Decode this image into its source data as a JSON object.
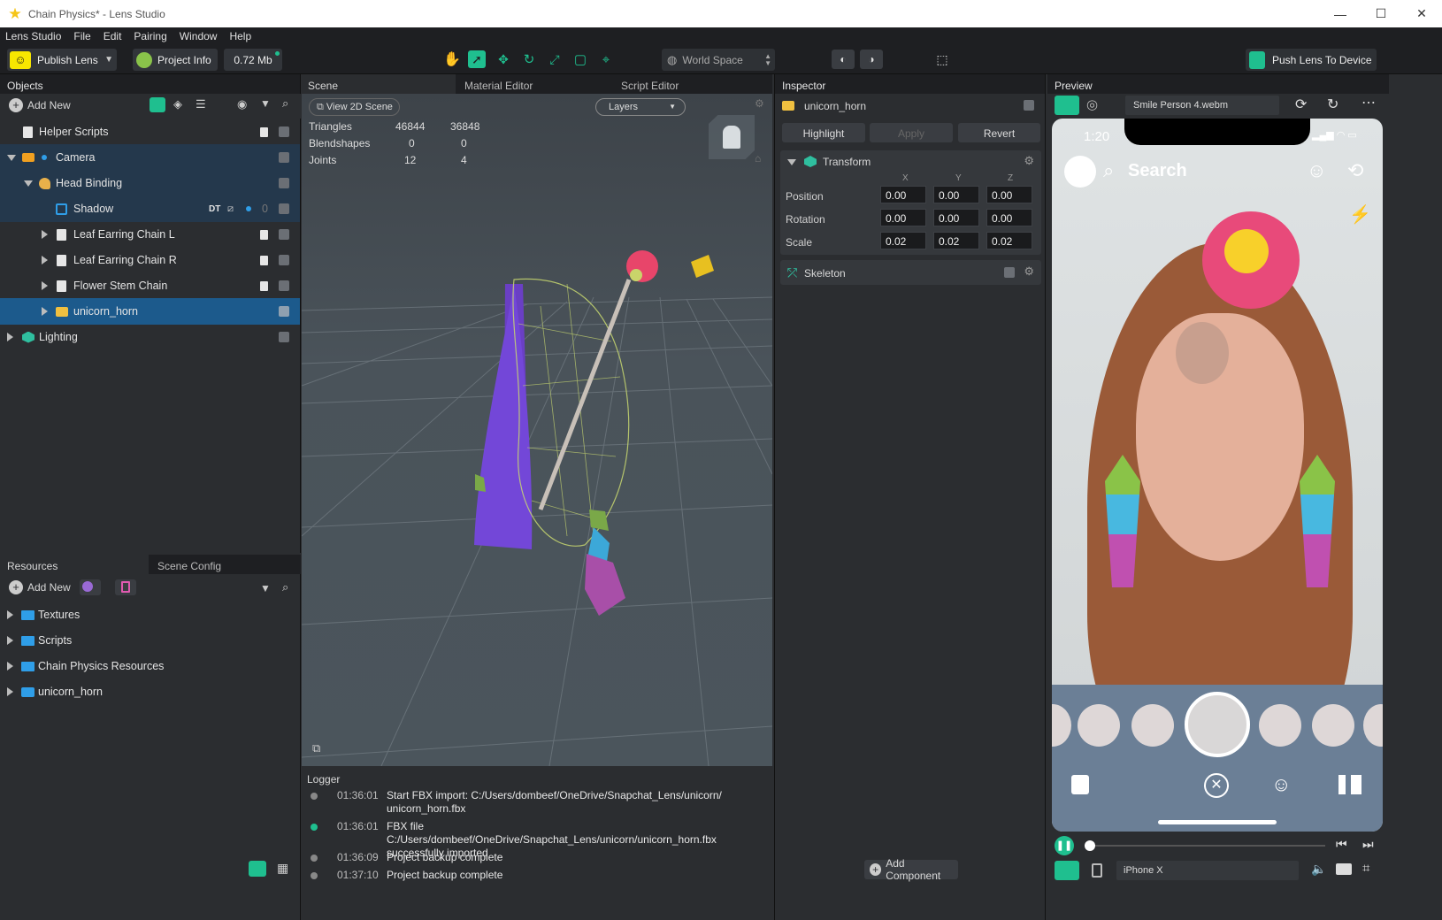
{
  "window": {
    "title": "Chain Physics* - Lens Studio",
    "min": "—",
    "max": "☐",
    "close": "✕"
  },
  "menu": [
    "Lens Studio",
    "File",
    "Edit",
    "Pairing",
    "Window",
    "Help"
  ],
  "toolbar": {
    "publish_label": "Publish Lens",
    "project_info_label": "Project Info",
    "size_label": "0.72 Mb",
    "space_label": "World Space",
    "push_label": "Push Lens To Device"
  },
  "objects": {
    "title": "Objects",
    "add_new": "Add New",
    "items": [
      {
        "label": "Helper Scripts"
      },
      {
        "label": "Camera"
      },
      {
        "label": "Head Binding"
      },
      {
        "label": "Shadow",
        "badge": "DT",
        "count": "0"
      },
      {
        "label": "Leaf Earring Chain L"
      },
      {
        "label": "Leaf Earring Chain R"
      },
      {
        "label": "Flower Stem Chain"
      },
      {
        "label": "unicorn_horn"
      },
      {
        "label": "Lighting"
      }
    ]
  },
  "resources": {
    "tab_resources": "Resources",
    "tab_scene_config": "Scene Config",
    "add_new": "Add New",
    "items": [
      {
        "label": "Textures"
      },
      {
        "label": "Scripts"
      },
      {
        "label": "Chain Physics Resources"
      },
      {
        "label": "unicorn_horn"
      }
    ]
  },
  "scene": {
    "tabs": [
      "Scene",
      "Material Editor",
      "Script Editor"
    ],
    "view2d": "View 2D Scene",
    "layers": "Layers",
    "stats": [
      {
        "name": "Triangles",
        "a": "46844",
        "b": "36848"
      },
      {
        "name": "Blendshapes",
        "a": "0",
        "b": "0"
      },
      {
        "name": "Joints",
        "a": "12",
        "b": "4"
      }
    ]
  },
  "logger": {
    "title": "Logger",
    "entries": [
      {
        "time": "01:36:01",
        "msg": "Start FBX import: C:/Users/dombeef/OneDrive/Snapchat_Lens/unicorn/ unicorn_horn.fbx",
        "color": "#8a8a8a"
      },
      {
        "time": "01:36:01",
        "msg": "FBX file C:/Users/dombeef/OneDrive/Snapchat_Lens/unicorn/unicorn_horn.fbx successfully imported",
        "color": "#1fbf8f"
      },
      {
        "time": "01:36:09",
        "msg": "Project backup complete",
        "color": "#8a8a8a"
      },
      {
        "time": "01:37:10",
        "msg": "Project backup complete",
        "color": "#8a8a8a"
      }
    ]
  },
  "inspector": {
    "title": "Inspector",
    "object_name": "unicorn_horn",
    "highlight": "Highlight",
    "apply": "Apply",
    "revert": "Revert",
    "transform": {
      "title": "Transform",
      "axes": [
        "X",
        "Y",
        "Z"
      ],
      "rows": [
        {
          "label": "Position",
          "values": [
            "0.00",
            "0.00",
            "0.00"
          ]
        },
        {
          "label": "Rotation",
          "values": [
            "0.00",
            "0.00",
            "0.00"
          ]
        },
        {
          "label": "Scale",
          "values": [
            "0.02",
            "0.02",
            "0.02"
          ]
        }
      ]
    },
    "skeleton": "Skeleton",
    "add_component": "Add Component"
  },
  "preview": {
    "title": "Preview",
    "source": "Smile Person 4.webm",
    "time": "1:20",
    "search": "Search",
    "device": "iPhone X"
  },
  "colors": {
    "accent": "#1fbf8f",
    "selection": "#1c5a8c",
    "folder": "#2f9ee8"
  }
}
